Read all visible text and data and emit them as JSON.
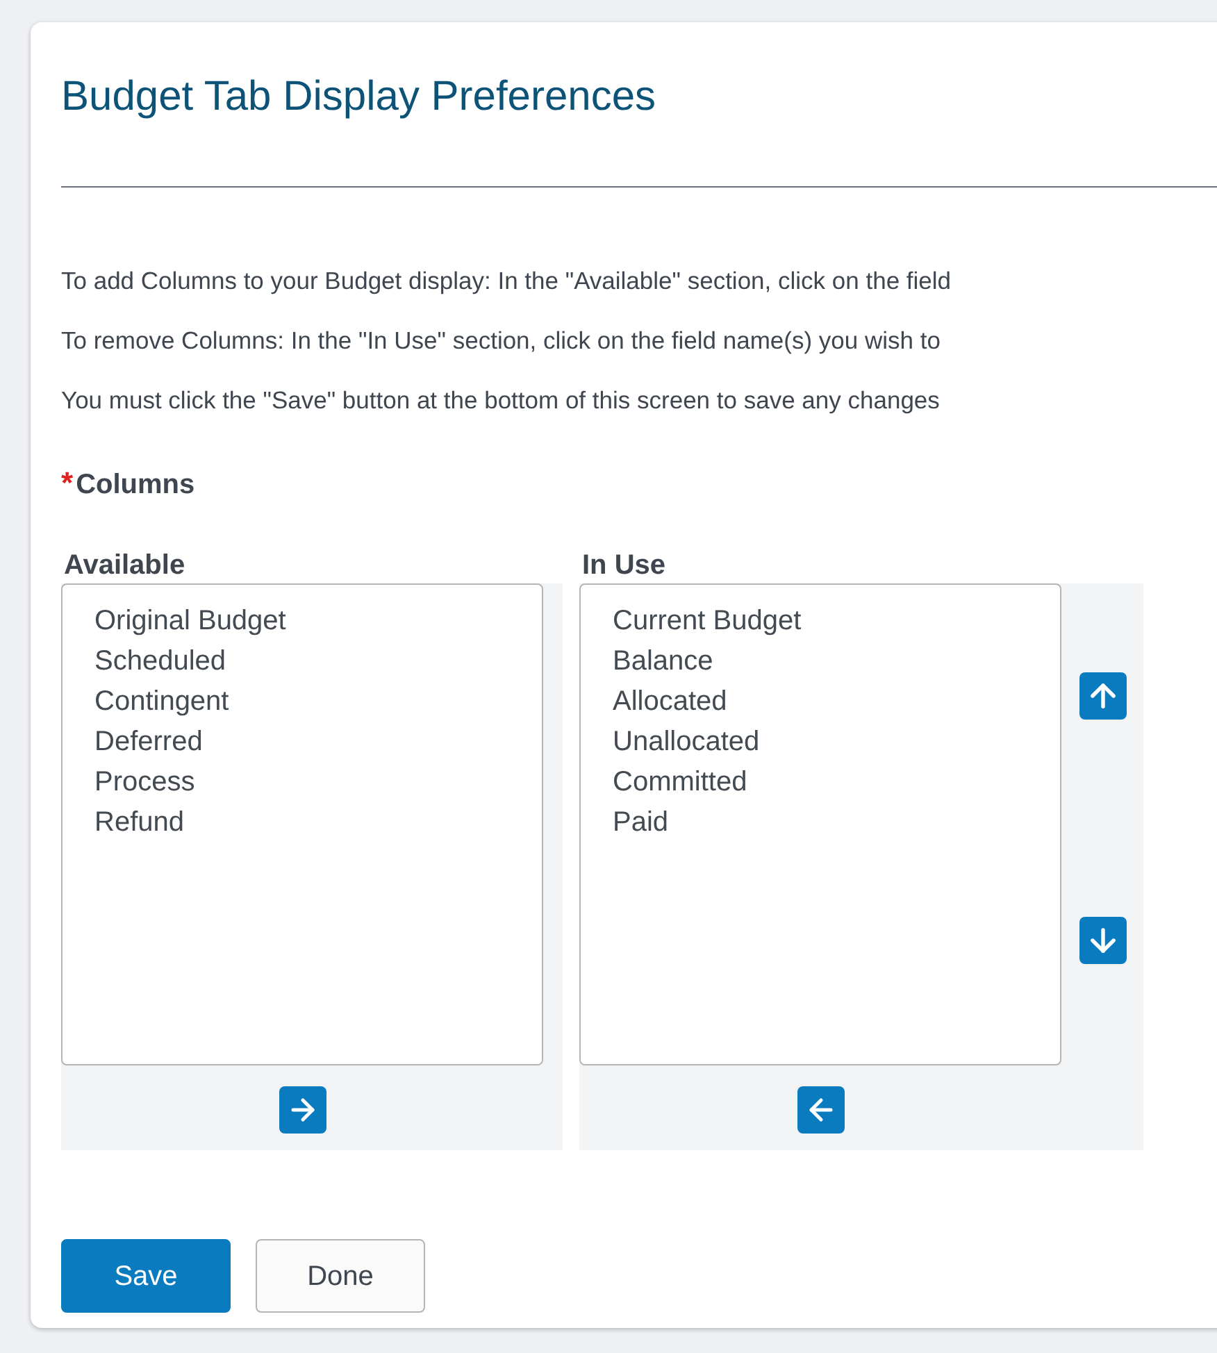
{
  "title": "Budget Tab Display Preferences",
  "instructions": [
    "To add Columns to your Budget display: In the \"Available\" section, click on the field",
    "To remove Columns: In the \"In Use\" section, click on the field name(s) you wish to",
    "You must click the \"Save\" button at the bottom of this screen to save any changes"
  ],
  "field": {
    "required_mark": "*",
    "label": "Columns"
  },
  "available": {
    "label": "Available",
    "items": [
      "Original Budget",
      "Scheduled",
      "Contingent",
      "Deferred",
      "Process",
      "Refund"
    ]
  },
  "in_use": {
    "label": "In Use",
    "items": [
      "Current Budget",
      "Balance",
      "Allocated",
      "Unallocated",
      "Committed",
      "Paid"
    ]
  },
  "buttons": [
    {
      "label": "Save",
      "kind": "primary"
    },
    {
      "label": "Done",
      "kind": "secondary"
    }
  ]
}
